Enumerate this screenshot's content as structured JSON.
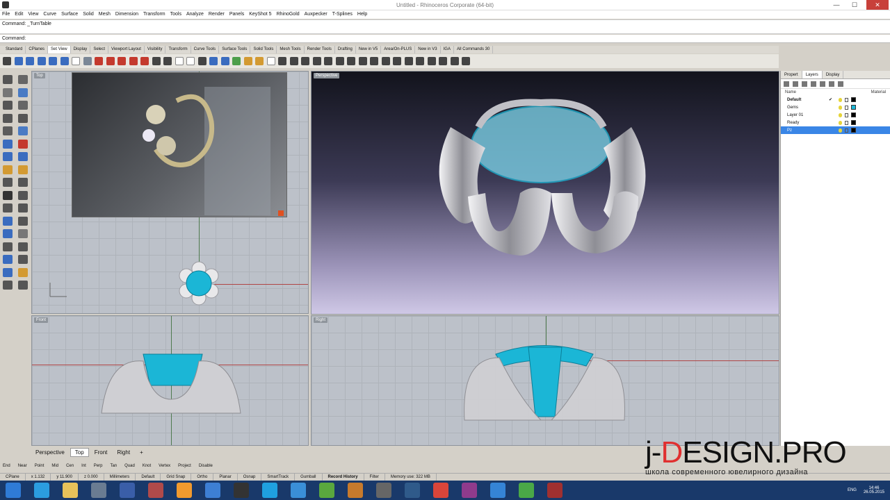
{
  "window": {
    "title": "Untitled - Rhinoceros Corporate (64-bit)",
    "controls": {
      "minimize": "—",
      "maximize": "☐",
      "close": "✕"
    }
  },
  "menu": [
    "File",
    "Edit",
    "View",
    "Curve",
    "Surface",
    "Solid",
    "Mesh",
    "Dimension",
    "Transform",
    "Tools",
    "Analyze",
    "Render",
    "Panels",
    "KeyShot 5",
    "RhinoGold",
    "Auxpecker",
    "T-Splines",
    "Help"
  ],
  "command": {
    "history": "Command: _TurnTable",
    "prompt": "Command:"
  },
  "toolbar_tabs": [
    "Standard",
    "CPlanes",
    "Set View",
    "Display",
    "Select",
    "Viewport Layout",
    "Visibility",
    "Transform",
    "Curve Tools",
    "Surface Tools",
    "Solid Tools",
    "Mesh Tools",
    "Render Tools",
    "Drafting",
    "New in V5",
    "Area/On-PLUS",
    "New in V3",
    "IGA",
    "All Commands 30"
  ],
  "active_toolbar_tab": "Set View",
  "viewports": {
    "top": "Top",
    "perspective": "Perspective",
    "front": "Front",
    "right": "Right"
  },
  "viewport_tabs": [
    "Perspective",
    "Top",
    "Front",
    "Right",
    "+"
  ],
  "active_viewport_tab": "Top",
  "osnaps": [
    "End",
    "Near",
    "Point",
    "Mid",
    "Cen",
    "Int",
    "Perp",
    "Tan",
    "Quad",
    "Knot",
    "Vertex",
    "Project",
    "Disable"
  ],
  "status": {
    "cplane": "CPlane",
    "x": "x 1.132",
    "y": "y 11.900",
    "z": "z 0.000",
    "units": "Millimeters",
    "layer": "Default",
    "grid_snap": "Grid Snap",
    "ortho": "Ortho",
    "planar": "Planar",
    "osnap": "Osnap",
    "smarttrack": "SmartTrack",
    "gumball": "Gumball",
    "record_history": "Record History",
    "filter": "Filter",
    "memory": "Memory use: 322 MB"
  },
  "panel": {
    "tabs": [
      "Propert",
      "Layers",
      "Display"
    ],
    "active_tab": "Layers",
    "columns": {
      "name": "Name",
      "material": "Material"
    },
    "layers": [
      {
        "name": "Default",
        "check": "✔",
        "color": "#000000"
      },
      {
        "name": "Gems",
        "check": "",
        "color": "#1bb6d6"
      },
      {
        "name": "Layer 01",
        "check": "",
        "color": "#000000"
      },
      {
        "name": "Ready",
        "check": "",
        "color": "#000000"
      },
      {
        "name": "Pz",
        "check": "",
        "color": "#000000"
      }
    ],
    "selected_layer": "Pz"
  },
  "taskbar": {
    "tray_lang": "ENG",
    "time": "14:46",
    "date": "26.05.2015"
  },
  "watermark": {
    "prefix": "j-",
    "accent": "D",
    "rest": "ESIGN.PRO",
    "subtitle": "школа современного ювелирного дизайна"
  },
  "colors": {
    "gem": "#1bb6d6",
    "metal": "#c9c9cc",
    "accent": "#e03030",
    "selection": "#3a86e6"
  }
}
